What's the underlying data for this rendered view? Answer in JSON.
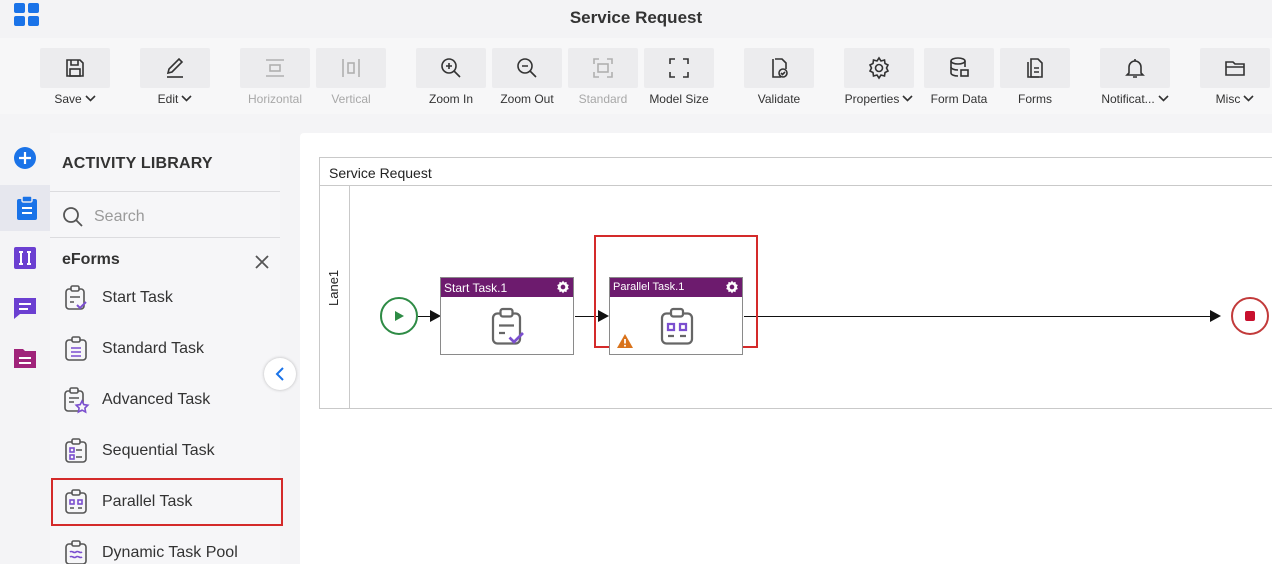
{
  "window": {
    "title": "Service Request"
  },
  "toolbar": {
    "items": [
      {
        "label": "Save",
        "icon": "save-icon",
        "dropdown": true,
        "enabled": true
      },
      {
        "label": "Edit",
        "icon": "pencil-icon",
        "dropdown": true,
        "enabled": true
      },
      {
        "label": "Horizontal",
        "icon": "align-horizontal-icon",
        "dropdown": false,
        "enabled": false
      },
      {
        "label": "Vertical",
        "icon": "align-vertical-icon",
        "dropdown": false,
        "enabled": false
      },
      {
        "label": "Zoom In",
        "icon": "zoom-in-icon",
        "dropdown": false,
        "enabled": true
      },
      {
        "label": "Zoom Out",
        "icon": "zoom-out-icon",
        "dropdown": false,
        "enabled": true
      },
      {
        "label": "Standard",
        "icon": "standard-size-icon",
        "dropdown": false,
        "enabled": false
      },
      {
        "label": "Model Size",
        "icon": "fit-screen-icon",
        "dropdown": false,
        "enabled": true
      },
      {
        "label": "Validate",
        "icon": "validate-icon",
        "dropdown": false,
        "enabled": true
      },
      {
        "label": "Properties",
        "icon": "gear-icon",
        "dropdown": true,
        "enabled": true
      },
      {
        "label": "Form Data",
        "icon": "database-icon",
        "dropdown": false,
        "enabled": true
      },
      {
        "label": "Forms",
        "icon": "forms-icon",
        "dropdown": false,
        "enabled": true
      },
      {
        "label": "Notificat...",
        "icon": "bell-icon",
        "dropdown": true,
        "enabled": true
      },
      {
        "label": "Misc",
        "icon": "folder-icon",
        "dropdown": true,
        "enabled": true
      }
    ]
  },
  "rail": {
    "items": [
      {
        "icon": "add-circle-icon",
        "color": "#1a73e8",
        "active": false
      },
      {
        "icon": "clipboard-icon",
        "color": "#1a73e8",
        "active": true
      },
      {
        "icon": "integration-icon",
        "color": "#6b3fd1",
        "active": false
      },
      {
        "icon": "chat-icon",
        "color": "#6b3fd1",
        "active": false
      },
      {
        "icon": "document-icon",
        "color": "#a0237a",
        "active": false
      }
    ]
  },
  "library": {
    "title": "ACTIVITY LIBRARY",
    "search": {
      "placeholder": "Search",
      "value": ""
    },
    "section": "eForms",
    "items": [
      {
        "label": "Start Task",
        "icon": "start-task-icon",
        "selected": false
      },
      {
        "label": "Standard Task",
        "icon": "standard-task-icon",
        "selected": false
      },
      {
        "label": "Advanced Task",
        "icon": "advanced-task-icon",
        "selected": false
      },
      {
        "label": "Sequential Task",
        "icon": "sequential-task-icon",
        "selected": false
      },
      {
        "label": "Parallel Task",
        "icon": "parallel-task-icon",
        "selected": true
      },
      {
        "label": "Dynamic Task Pool",
        "icon": "dynamic-task-pool-icon",
        "selected": false
      }
    ]
  },
  "canvas": {
    "pool_title": "Service Request",
    "lane_label": "Lane1",
    "tasks": [
      {
        "name": "Start Task.1",
        "icon": "start-task-icon",
        "warning": false,
        "highlighted": false
      },
      {
        "name": "Parallel Task.1",
        "icon": "parallel-task-icon",
        "warning": true,
        "highlighted": true
      }
    ]
  },
  "colors": {
    "accent": "#1a73e8",
    "task_header": "#6d1b6e",
    "start_event": "#2e8b45",
    "end_event": "#c8102e",
    "highlight": "#d42a2a",
    "warning": "#d9731c"
  }
}
